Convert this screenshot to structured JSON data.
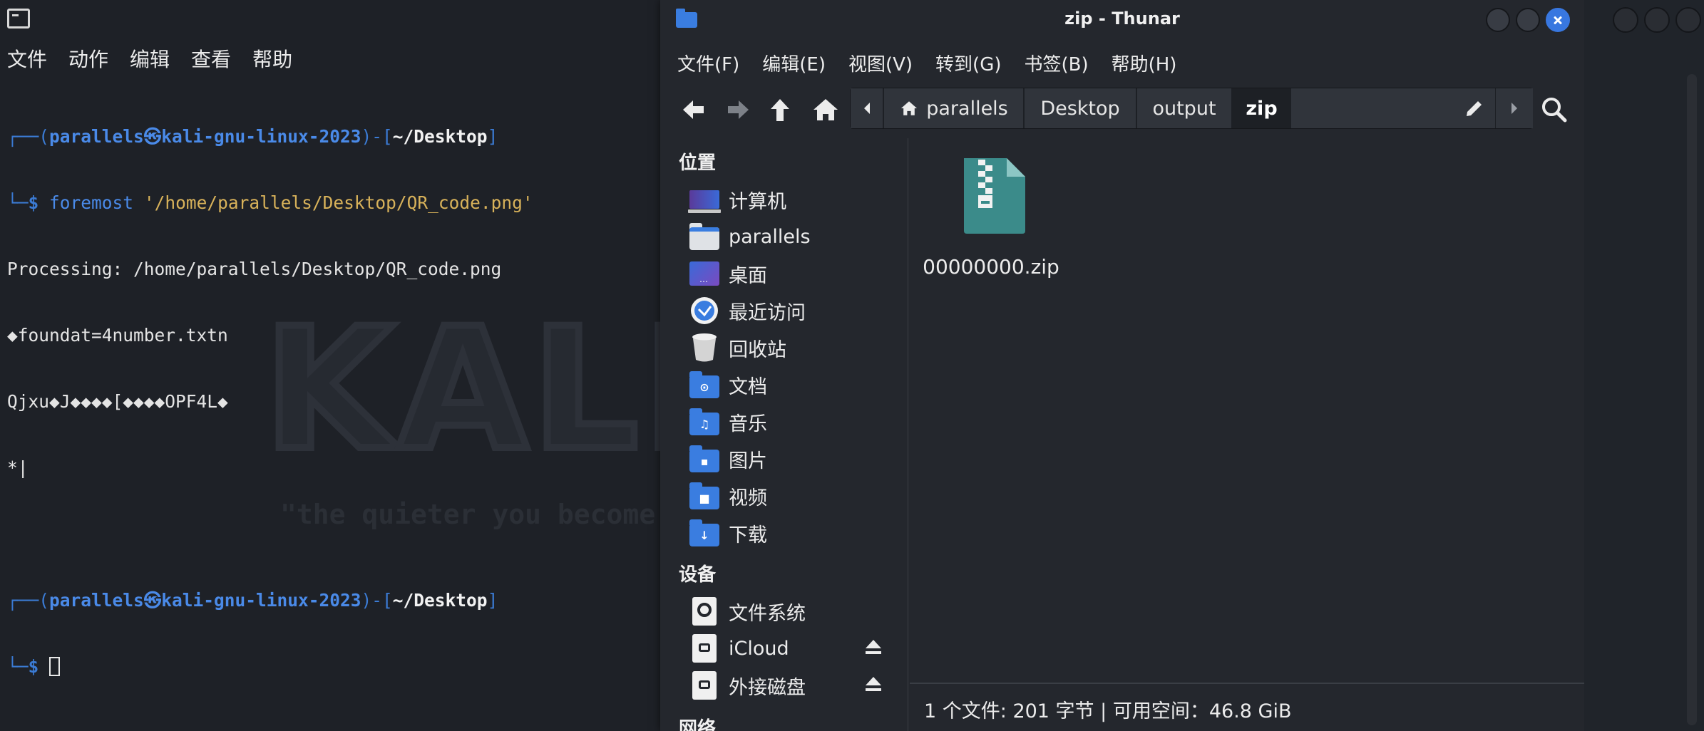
{
  "terminal": {
    "menu": [
      "文件",
      "动作",
      "编辑",
      "查看",
      "帮助"
    ],
    "prompt": {
      "corner_top": "┌──(",
      "user_host": "parallels㉿kali-gnu-linux-2023",
      "mid": ")-[",
      "dir": "~/Desktop",
      "close": "]",
      "corner_bottom": "└─",
      "symbol": "$"
    },
    "command": "foremost",
    "command_arg": " '/home/parallels/Desktop/QR_code.png'",
    "output_lines": [
      "Processing: /home/parallels/Desktop/QR_code.png",
      "◆foundat=4number.txtn",
      "Qjxu◆J◆◆◆◆[◆◆◆◆OPF4L◆",
      "*|"
    ],
    "watermark": {
      "logo": "KALI",
      "slogan": "\"the quieter you become"
    }
  },
  "thunar": {
    "title": "zip - Thunar",
    "menu": [
      "文件(F)",
      "编辑(E)",
      "视图(V)",
      "转到(G)",
      "书签(B)",
      "帮助(H)"
    ],
    "breadcrumbs": [
      "parallels",
      "Desktop",
      "output",
      "zip"
    ],
    "sidebar": {
      "places_heading": "位置",
      "places": [
        {
          "label": "计算机",
          "icon": "computer-icon"
        },
        {
          "label": "parallels",
          "icon": "home-folder-icon"
        },
        {
          "label": "桌面",
          "icon": "desktop-icon"
        },
        {
          "label": "最近访问",
          "icon": "recent-icon"
        },
        {
          "label": "回收站",
          "icon": "trash-icon"
        },
        {
          "label": "文档",
          "icon": "documents-folder-icon"
        },
        {
          "label": "音乐",
          "icon": "music-folder-icon"
        },
        {
          "label": "图片",
          "icon": "pictures-folder-icon"
        },
        {
          "label": "视频",
          "icon": "videos-folder-icon"
        },
        {
          "label": "下载",
          "icon": "downloads-folder-icon"
        }
      ],
      "devices_heading": "设备",
      "devices": [
        {
          "label": "文件系统",
          "icon": "filesystem-icon"
        },
        {
          "label": "iCloud",
          "icon": "drive-icon",
          "eject": true
        },
        {
          "label": "外接磁盘",
          "icon": "drive-icon",
          "eject": true
        }
      ],
      "network_heading": "网络"
    },
    "files": [
      {
        "name": "00000000.zip",
        "icon": "zip-archive-icon"
      }
    ],
    "status": "1 个文件: 201 字节  |  可用空间：46.8 GiB"
  },
  "colors": {
    "accent": "#3a7de0",
    "prompt_blue": "#4a8ae8",
    "arg_yellow": "#d8b25a",
    "zip_teal": "#3b8b8a"
  }
}
